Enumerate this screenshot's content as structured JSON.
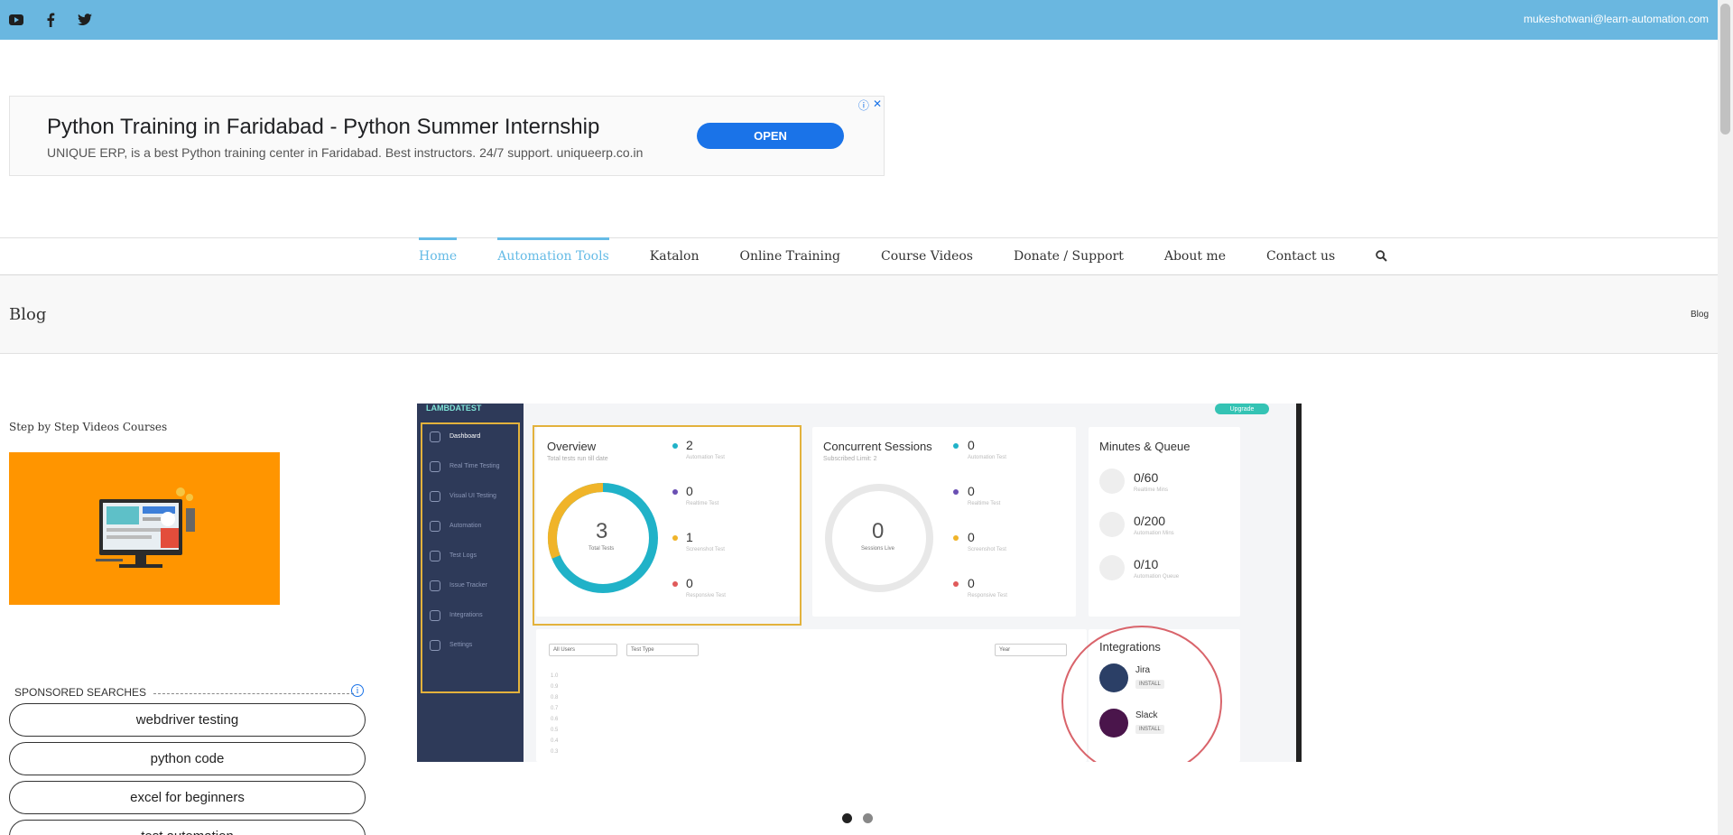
{
  "topbar": {
    "social_icons": [
      "youtube-icon",
      "facebook-icon",
      "twitter-icon"
    ],
    "email": "mukeshotwani@learn-automation.com",
    "bg_color": "#6ab7e0"
  },
  "ad": {
    "headline": "Python Training in Faridabad - Python Summer Internship",
    "description": "UNIQUE ERP, is a best Python training center in Faridabad. Best instructors. 24/7 support. uniqueerp.co.in",
    "button": "OPEN"
  },
  "nav": {
    "items": [
      {
        "label": "Home",
        "active": true
      },
      {
        "label": "Automation Tools",
        "active": true
      },
      {
        "label": "Katalon",
        "active": false
      },
      {
        "label": "Online Training",
        "active": false
      },
      {
        "label": "Course Videos",
        "active": false
      },
      {
        "label": "Donate / Support",
        "active": false
      },
      {
        "label": "About me",
        "active": false
      },
      {
        "label": "Contact us",
        "active": false
      }
    ],
    "accent": "#65bbe6"
  },
  "page": {
    "title": "Blog",
    "breadcrumb": "Blog"
  },
  "sidebar": {
    "heading": "Step by Step Videos Courses",
    "promo_bg": "#ff9500",
    "sponsored_label": "SPONSORED SEARCHES",
    "searches": [
      "webdriver testing",
      "python code",
      "excel for beginners",
      "test automation"
    ]
  },
  "slider": {
    "dots": 2,
    "active_dot": 0,
    "dashboard": {
      "logo": "LAMBDATEST",
      "upgrade": "Upgrade",
      "menu": [
        "Dashboard",
        "Real Time Testing",
        "Visual UI Testing",
        "Automation",
        "Test Logs",
        "Issue Tracker",
        "Integrations",
        "Settings"
      ],
      "overview": {
        "title": "Overview",
        "subtitle": "Total tests run till date",
        "total": "3",
        "total_label": "Total Tests",
        "metrics": [
          {
            "value": "2",
            "label": "Automation Test",
            "color": "#20b2c8"
          },
          {
            "value": "0",
            "label": "Realtime Test",
            "color": "#6a4fb3"
          },
          {
            "value": "1",
            "label": "Screenshot Test",
            "color": "#f0b429"
          },
          {
            "value": "0",
            "label": "Responsive Test",
            "color": "#e05a5a"
          }
        ]
      },
      "concurrent": {
        "title": "Concurrent Sessions",
        "subtitle": "Subscribed Limit: 2",
        "live": "0",
        "live_label": "Sessions Live",
        "metrics": [
          {
            "value": "0",
            "label": "Automation Test",
            "color": "#20b2c8"
          },
          {
            "value": "0",
            "label": "Realtime Test",
            "color": "#6a4fb3"
          },
          {
            "value": "0",
            "label": "Screenshot Test",
            "color": "#f0b429"
          },
          {
            "value": "0",
            "label": "Responsive Test",
            "color": "#e05a5a"
          }
        ]
      },
      "minutes": {
        "title": "Minutes & Queue",
        "rows": [
          {
            "value": "0/60",
            "label": "Realtime Mins"
          },
          {
            "value": "0/200",
            "label": "Automation Mins"
          },
          {
            "value": "0/10",
            "label": "Automation Queue"
          }
        ]
      },
      "filters": [
        "All Users",
        "Test Type",
        "Year"
      ],
      "y_ticks": [
        "1.0",
        "0.9",
        "0.8",
        "0.7",
        "0.6",
        "0.5",
        "0.4",
        "0.3"
      ],
      "integrations": {
        "title": "Integrations",
        "items": [
          {
            "name": "Jira",
            "button": "INSTALL"
          },
          {
            "name": "Slack",
            "button": "INSTALL"
          }
        ]
      }
    }
  }
}
